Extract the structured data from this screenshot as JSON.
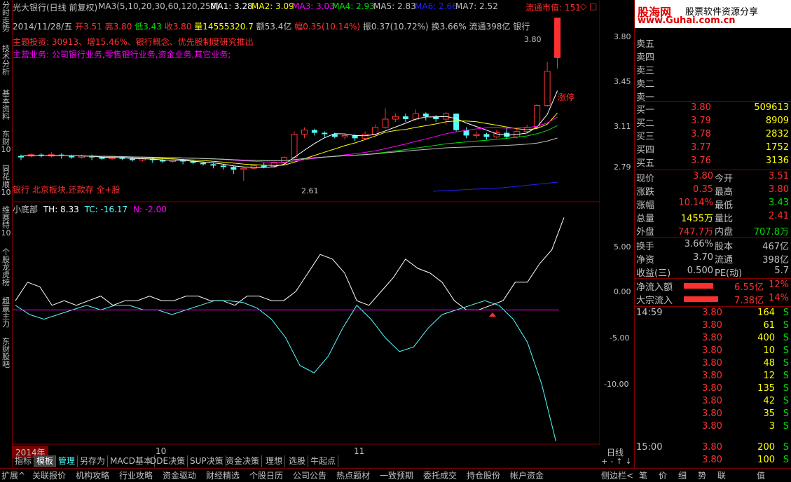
{
  "vtabs": [
    "分时走势",
    "技术分析",
    "基本资料",
    "东财10",
    "同花顺10",
    "维赛特10",
    "个股龙虎榜",
    "超赢主力",
    "东财股吧"
  ],
  "header": {
    "title": "光大银行(日线 前复权)",
    "ma_label": "MA3(5,10,20,30,60,120,250)",
    "ma1": "MA1: 3.28",
    "ma2": "MA2: 3.09",
    "ma3": "MA3: 3.03",
    "ma4": "MA4: 2.93",
    "ma5": "MA5: 2.83",
    "ma6": "MA6: 2.66",
    "ma7": "MA7: 2.52",
    "float_value": "流通市值: 151",
    "diamond": "◇ □"
  },
  "quote_line": {
    "date": "2014/11/28/五",
    "open": "开3.51",
    "high": "高3.80",
    "low": "低3.43",
    "close": "收3.80",
    "vol": "量14555320.7",
    "amount": "额53.4亿",
    "pct": "幅0.35(10.14%)",
    "amp": "振0.37(10.72%)",
    "turnover": "换3.66%",
    "float": "流通398亿",
    "industry": "银行"
  },
  "themes": "主题投资: 30913、增15.46%、银行概念、优先股制度研究推出",
  "business": "主营业务: 公司银行业务,零售银行业务,资金业务,其它业务;",
  "price_axis": [
    "3.80",
    "3.45",
    "3.11",
    "2.79"
  ],
  "annot_high": "3.80",
  "annot_low": "2.61",
  "annot_limit": "涨停",
  "news": "银行 北京板块,还款存 全+股",
  "indicator": {
    "name": "小底部",
    "th": "TH: 8.33",
    "tc": "TC: -16.17",
    "n": "N: -2.00"
  },
  "ind_axis": [
    "5.00",
    "0.00",
    "-5.00",
    "-10.00"
  ],
  "time_axis": {
    "y2014": "2014年",
    "m10": "10",
    "m11": "11",
    "period": "日线"
  },
  "bottom_tabs": [
    "指标",
    "模板",
    "管理",
    "另存为",
    "MACD基本",
    "DDE决策",
    "SUP决策",
    "资金决策",
    "理想",
    "选股",
    "牛起点"
  ],
  "status_tabs": [
    "扩展^",
    "关联报价",
    "机构攻略",
    "行业攻略",
    "资金驱动",
    "财经精选",
    "个股日历",
    "公司公告",
    "热点题材",
    "一致预期",
    "委托成交",
    "持仓股份",
    "帐户资金"
  ],
  "status_right": [
    "侧边栏<",
    "笔",
    "价",
    "细",
    "势",
    "联",
    "值"
  ],
  "logo": {
    "text1": "股海网",
    "text2": "股票软件资源分享",
    "url": "www.Guhai.com.cn"
  },
  "order_book": {
    "sells": [
      {
        "label": "卖五"
      },
      {
        "label": "卖四"
      },
      {
        "label": "卖三"
      },
      {
        "label": "卖二"
      },
      {
        "label": "卖一"
      }
    ],
    "buys": [
      {
        "label": "买一",
        "price": "3.80",
        "vol": "509613"
      },
      {
        "label": "买二",
        "price": "3.79",
        "vol": "8909"
      },
      {
        "label": "买三",
        "price": "3.78",
        "vol": "2832"
      },
      {
        "label": "买四",
        "price": "3.77",
        "vol": "1752"
      },
      {
        "label": "买五",
        "price": "3.76",
        "vol": "3136"
      }
    ]
  },
  "stats": [
    {
      "l1": "现价",
      "v1": "3.80",
      "l2": "今开",
      "v2": "3.51"
    },
    {
      "l1": "涨跌",
      "v1": "0.35",
      "l2": "最高",
      "v2": "3.80"
    },
    {
      "l1": "涨幅",
      "v1": "10.14%",
      "l2": "最低",
      "v2": "3.43"
    },
    {
      "l1": "总量",
      "v1": "1455万",
      "l2": "量比",
      "v2": "2.41"
    },
    {
      "l1": "外盘",
      "v1": "747.7万",
      "l2": "内盘",
      "v2": "707.8万"
    }
  ],
  "stats2": [
    {
      "l1": "换手",
      "v1": "3.66%",
      "l2": "股本",
      "v2": "467亿"
    },
    {
      "l1": "净资",
      "v1": "3.70",
      "l2": "流通",
      "v2": "398亿"
    },
    {
      "l1": "收益(三)",
      "v1": "0.500",
      "l2": "PE(动)",
      "v2": "5.7"
    }
  ],
  "flows": [
    {
      "label": "净流入额",
      "val": "6.55亿",
      "pct": "12%",
      "bar": 0.6
    },
    {
      "label": "大宗流入",
      "val": "7.38亿",
      "pct": "14%",
      "bar": 0.7
    }
  ],
  "ticks": [
    {
      "time": "14:59",
      "price": "3.80",
      "vol": "164",
      "bs": "S"
    },
    {
      "time": "",
      "price": "3.80",
      "vol": "61",
      "bs": "S"
    },
    {
      "time": "",
      "price": "3.80",
      "vol": "400",
      "bs": "S"
    },
    {
      "time": "",
      "price": "3.80",
      "vol": "10",
      "bs": "S"
    },
    {
      "time": "",
      "price": "3.80",
      "vol": "48",
      "bs": "S"
    },
    {
      "time": "",
      "price": "3.80",
      "vol": "12",
      "bs": "S"
    },
    {
      "time": "",
      "price": "3.80",
      "vol": "135",
      "bs": "S"
    },
    {
      "time": "",
      "price": "3.80",
      "vol": "42",
      "bs": "S"
    },
    {
      "time": "",
      "price": "3.80",
      "vol": "35",
      "bs": "S"
    },
    {
      "time": "",
      "price": "3.80",
      "vol": "3",
      "bs": "S"
    },
    {
      "time": "15:00",
      "price": "3.80",
      "vol": "200",
      "bs": "S"
    },
    {
      "time": "",
      "price": "3.80",
      "vol": "100",
      "bs": "S"
    }
  ],
  "colors": {
    "red": "#ff3030",
    "green": "#00e000",
    "yellow": "#ffff00",
    "cyan": "#54ffff",
    "white": "#ffffff",
    "magenta": "#ff00ff",
    "blue": "#2020ff",
    "grid": "#800000"
  }
}
